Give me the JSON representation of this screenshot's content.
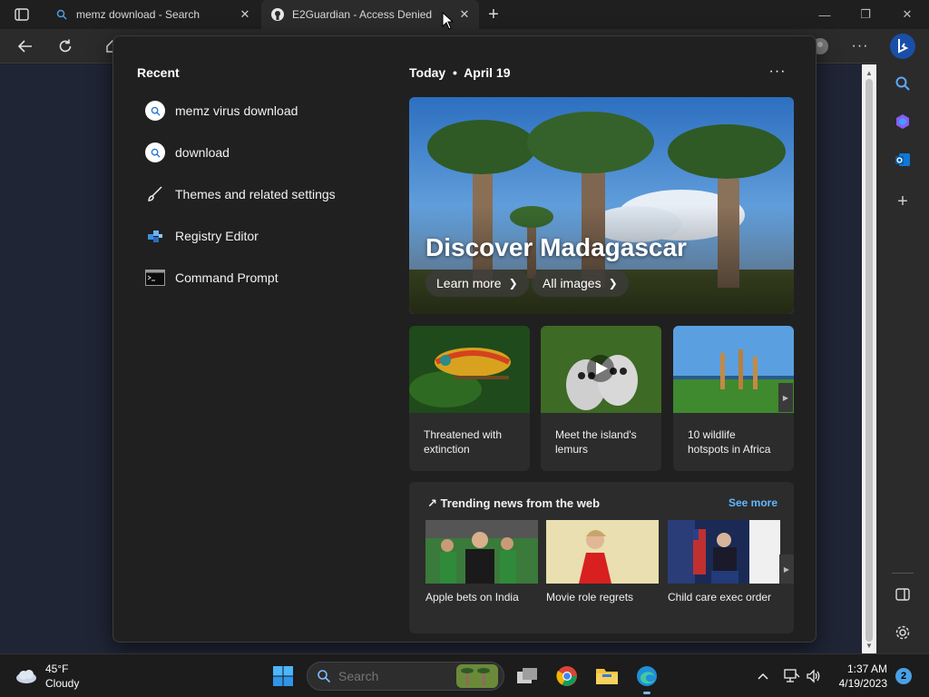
{
  "browser": {
    "tabs": [
      {
        "title": "memz download - Search",
        "icon": "search-icon"
      },
      {
        "title": "E2Guardian - Access Denied",
        "icon": "github-icon"
      }
    ]
  },
  "flyout": {
    "recent_title": "Recent",
    "recent_items": [
      {
        "label": "memz virus download",
        "icon": "search-icon"
      },
      {
        "label": "download",
        "icon": "search-icon"
      },
      {
        "label": "Themes and related settings",
        "icon": "brush-icon"
      },
      {
        "label": "Registry Editor",
        "icon": "registry-icon"
      },
      {
        "label": "Command Prompt",
        "icon": "terminal-icon"
      }
    ],
    "today_label": "Today",
    "date": "April 19",
    "hero": {
      "title": "Discover Madagascar",
      "learn_more": "Learn more",
      "all_images": "All images"
    },
    "cards": [
      {
        "caption": "Threatened with extinction"
      },
      {
        "caption": "Meet the island's lemurs"
      },
      {
        "caption": "10 wildlife hotspots in Africa"
      }
    ],
    "trending": {
      "title": "Trending news from the web",
      "see_more": "See more",
      "items": [
        {
          "caption": "Apple bets on India"
        },
        {
          "caption": "Movie role regrets"
        },
        {
          "caption": "Child care exec order"
        }
      ]
    }
  },
  "taskbar": {
    "weather": {
      "temp": "45°F",
      "condition": "Cloudy"
    },
    "search_placeholder": "Search",
    "time": "1:37 AM",
    "date": "4/19/2023",
    "notifications": "2"
  },
  "colors": {
    "accent": "#61b8ff",
    "flyout_bg": "#202020",
    "card_bg": "#2c2c2c"
  }
}
